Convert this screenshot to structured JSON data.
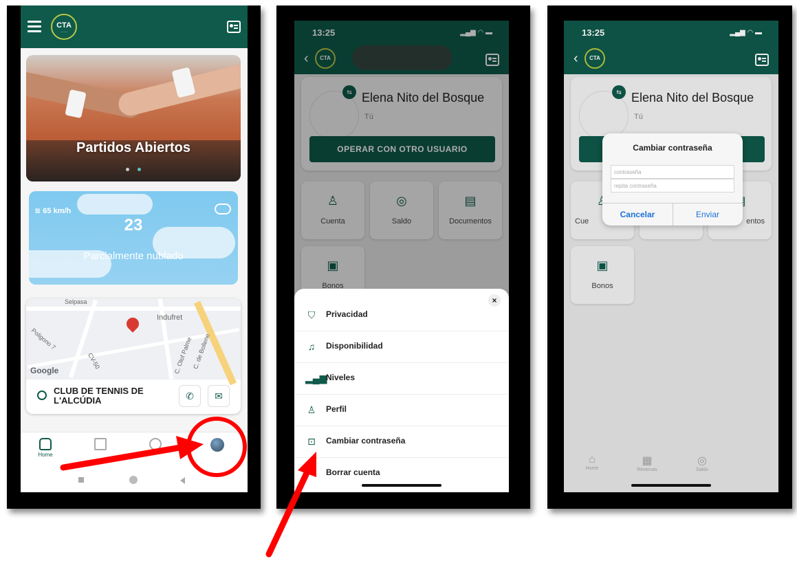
{
  "screen1": {
    "logo": "CTA",
    "promo_title": "Partidos Abiertos",
    "weather": {
      "wind": "65 km/h",
      "temperature": "23",
      "description": "Parcialmente nublado"
    },
    "map": {
      "labels": [
        "Selpasa",
        "Indufret",
        "Poligono 7",
        "CV-50",
        "C. Olof Palme",
        "C. de Bollene"
      ],
      "provider": "Google"
    },
    "club_name": "CLUB DE TENNIS DE L'ALCÚDIA",
    "nav_home": "Home"
  },
  "screen2": {
    "time": "13:25",
    "logo": "CTA",
    "user_name": "Elena Nito del Bosque",
    "user_sub": "Tú",
    "operate_button": "OPERAR CON OTRO USUARIO",
    "tiles": [
      "Cuenta",
      "Saldo",
      "Documentos",
      "Bonos"
    ],
    "menu": [
      "Privacidad",
      "Disponibilidad",
      "Niveles",
      "Perfil",
      "Cambiar contraseña",
      "Borrar cuenta"
    ],
    "close": "×"
  },
  "screen3": {
    "time": "13:25",
    "logo": "CTA",
    "user_name": "Elena Nito del Bosque",
    "user_sub": "Tú",
    "tiles": [
      "Cue",
      "entos",
      "Bonos"
    ],
    "dialog": {
      "title": "Cambiar contraseña",
      "placeholder1": "contraseña",
      "placeholder2": "repita contraseña",
      "cancel": "Cancelar",
      "send": "Enviar"
    },
    "nav": [
      "Home",
      "Reservas",
      "Saldo"
    ]
  },
  "colors": {
    "brand": "#0f5a4a",
    "accent": "#b9c843",
    "annotation": "#ff0000",
    "ios_link": "#1b73d9"
  }
}
